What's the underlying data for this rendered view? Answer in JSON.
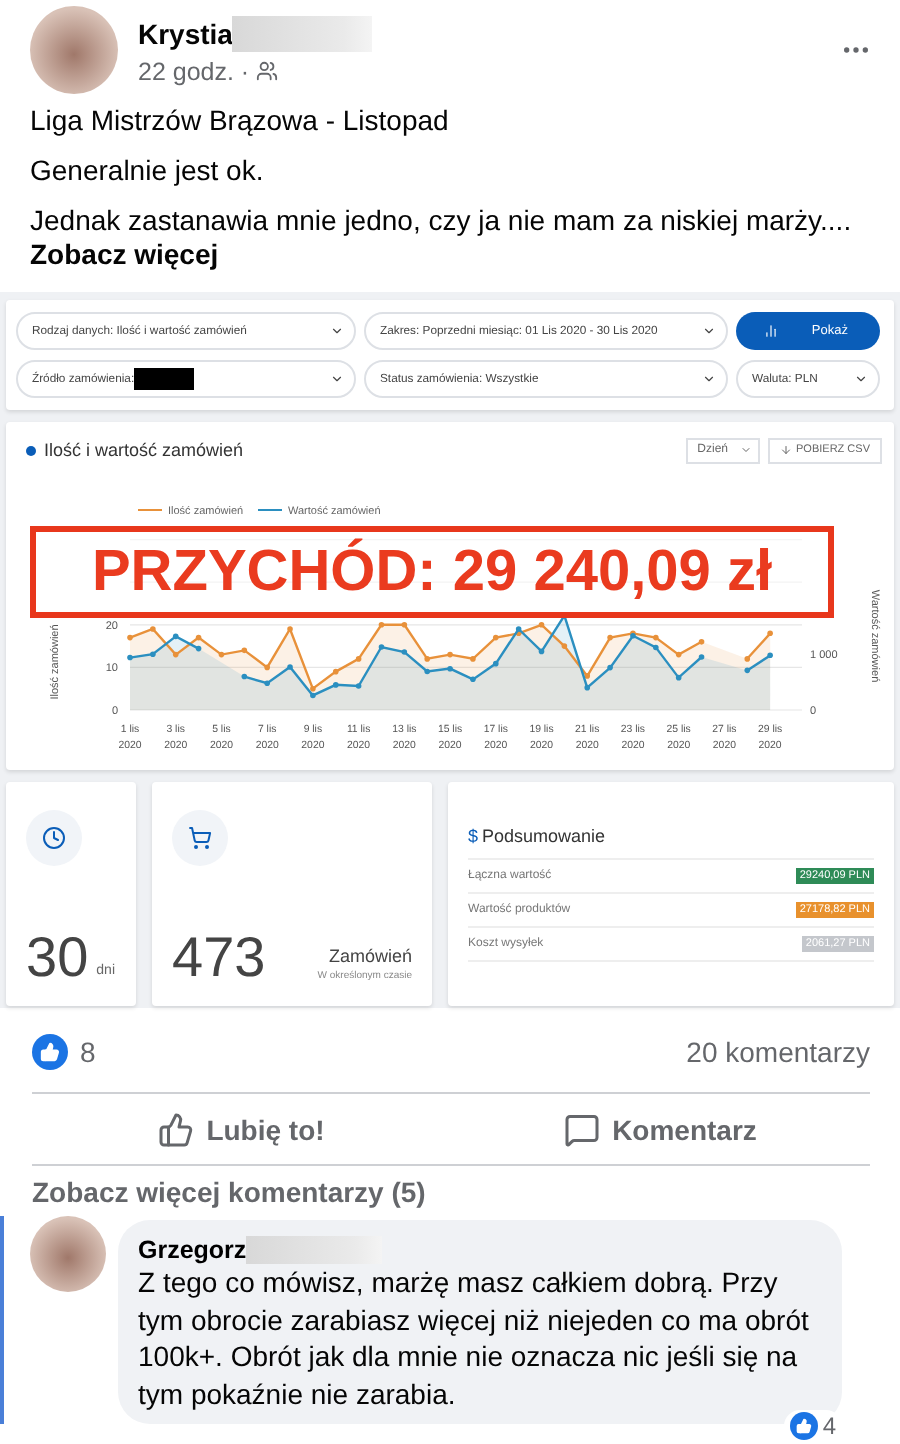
{
  "post": {
    "author": "Krystia",
    "time": "22 godz. ·",
    "title": "Liga Mistrzów Brązowa - Listopad",
    "paragraphs": [
      "Generalnie jest ok.",
      "Jednak zastanawia mnie jedno, czy ja nie mam za niskiej marży...."
    ],
    "see_more": "Zobacz więcej"
  },
  "dashboard": {
    "filters": [
      {
        "label": "Rodzaj danych: Ilość i wartość zamówień"
      },
      {
        "label": "Zakres: Poprzedni miesiąc: 01 Lis 2020 - 30 Lis 2020"
      },
      {
        "label": "Źródło zamówienia:",
        "redacted": true
      },
      {
        "label": "Status zamówienia: Wszystkie"
      },
      {
        "label": "Waluta: PLN"
      }
    ],
    "show_button": "Pokaż",
    "chart_title": "Ilość i wartość zamówień",
    "period": "Dzień",
    "csv_button": "POBIERZ CSV",
    "overlay": "PRZYCHÓD: 29 240,09 zł",
    "chart_data": {
      "type": "area",
      "legend": true,
      "categories": [
        "1 lis 2020",
        null,
        "3 lis 2020",
        null,
        "5 lis 2020",
        null,
        "7 lis 2020",
        null,
        "9 lis 2020",
        null,
        "11 lis 2020",
        null,
        "13 lis 2020",
        null,
        "15 lis 2020",
        null,
        "17 lis 2020",
        null,
        "19 lis 2020",
        null,
        "21 lis 2020",
        null,
        "23 lis 2020",
        null,
        "25 lis 2020",
        null,
        "27 lis 2020",
        null,
        "29 lis 2020",
        null
      ],
      "ylabel": "Ilość zamówień",
      "y2label": "Wartość zamówień",
      "series": [
        {
          "name": "Ilość zamówień",
          "color": "#e8913a",
          "values": [
            17,
            19,
            13,
            17,
            13,
            14,
            10,
            19,
            5,
            9,
            12,
            20,
            20,
            12,
            13,
            12,
            17,
            18,
            20,
            15,
            8,
            17,
            18,
            17,
            13,
            16,
            null,
            12,
            18,
            null
          ]
        },
        {
          "name": "Wartość zamówień",
          "color": "#2b8fc0",
          "axis": "y2",
          "values": [
            940,
            1000,
            1320,
            1100,
            null,
            600,
            480,
            770,
            260,
            450,
            430,
            1130,
            1040,
            690,
            740,
            550,
            830,
            1450,
            1050,
            1690,
            400,
            760,
            1330,
            1120,
            580,
            950,
            null,
            710,
            980,
            null
          ]
        }
      ],
      "ylim": [
        0,
        40
      ],
      "yticks": [
        0,
        10,
        20
      ],
      "y2lim": [
        0,
        3053
      ],
      "y2ticks": [
        {
          "value": 0,
          "label": "0"
        },
        {
          "value": 1000,
          "label": "1 000"
        }
      ]
    },
    "stats": [
      {
        "kind": "days",
        "value": "30",
        "unit": "dni"
      },
      {
        "kind": "orders",
        "value": "473",
        "unit": "Zamówień",
        "note": "W określonym czasie"
      }
    ],
    "summary": {
      "symbol": "$",
      "title": "Podsumowanie",
      "rows": [
        {
          "label": "Łączna wartość",
          "value": "29240,09 PLN",
          "color": "#2e8b57"
        },
        {
          "label": "Wartość produktów",
          "value": "27178,82 PLN",
          "color": "#e8912d"
        },
        {
          "label": "Koszt wysyłek",
          "value": "2061,27 PLN",
          "color": "#c4c7cc"
        }
      ]
    }
  },
  "reactions": {
    "likes": "8",
    "comments": "20 komentarzy"
  },
  "actions": [
    {
      "kind": "like",
      "label": "Lubię to!"
    },
    {
      "kind": "comment",
      "label": "Komentarz"
    }
  ],
  "more_comments": "Zobacz więcej komentarzy (5)",
  "comment": {
    "author": "Grzegorz",
    "text": "Z tego co mówisz, marżę masz całkiem dobrą. Przy tym obrocie zarabiasz więcej niż niejeden co ma obrót 100k+. Obrót jak dla mnie nie oznacza nic jeśli się na tym pokaźnie nie zarabia.",
    "likes": "4"
  }
}
